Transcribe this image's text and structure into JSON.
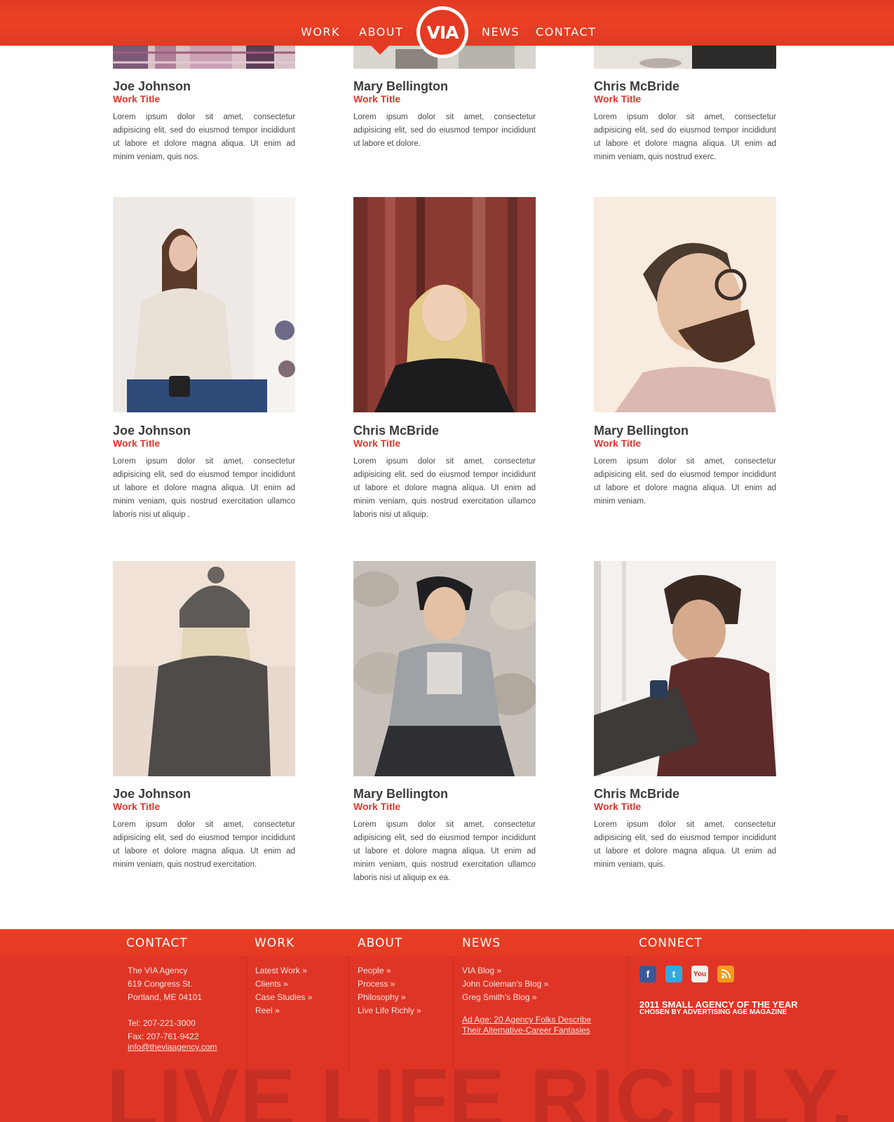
{
  "nav": {
    "items": [
      "WORK",
      "ABOUT",
      "NEWS",
      "CONTACT"
    ],
    "logo": "VIA",
    "active": "ABOUT"
  },
  "profiles": [
    {
      "name": "Joe Johnson",
      "title": "Work Title",
      "bio": "Lorem ipsum dolor sit amet, consectetur adipisicing elit, sed do eiusmod tempor incididunt ut labore et dolore magna aliqua. Ut enim ad minim veniam, quis nos."
    },
    {
      "name": "Mary Bellington",
      "title": "Work Title",
      "bio": "Lorem ipsum dolor sit amet, consectetur adipisicing elit, sed do eiusmod tempor incididunt ut labore et dolore."
    },
    {
      "name": "Chris McBride",
      "title": "Work Title",
      "bio": "Lorem ipsum dolor sit amet, consectetur adipisicing elit, sed do eiusmod tempor incididunt ut labore et dolore magna aliqua. Ut enim ad minim veniam, quis nostrud exerc."
    },
    {
      "name": "Joe Johnson",
      "title": "Work Title",
      "bio": "Lorem ipsum dolor sit amet, consectetur adipisicing elit, sed do eiusmod tempor incididunt ut labore et dolore magna aliqua. Ut enim ad minim veniam, quis nostrud exercitation ullamco laboris nisi ut aliquip ."
    },
    {
      "name": "Chris McBride",
      "title": "Work Title",
      "bio": "Lorem ipsum dolor sit amet, consectetur adipisicing elit, sed do eiusmod tempor incididunt ut labore et dolore magna aliqua. Ut enim ad minim veniam, quis nostrud exercitation ullamco laboris nisi ut aliquip."
    },
    {
      "name": "Mary Bellington",
      "title": "Work Title",
      "bio": "Lorem ipsum dolor sit amet, consectetur adipisicing elit, sed do eiusmod tempor incididunt ut labore et dolore magna aliqua. Ut enim ad minim veniam."
    },
    {
      "name": "Joe Johnson",
      "title": "Work Title",
      "bio": "Lorem ipsum dolor sit amet, consectetur adipisicing elit, sed do eiusmod tempor incididunt ut labore et dolore magna aliqua. Ut enim ad minim veniam, quis nostrud exercitation."
    },
    {
      "name": "Mary Bellington",
      "title": "Work Title",
      "bio": "Lorem ipsum dolor sit amet, consectetur adipisicing elit, sed do eiusmod tempor incididunt ut labore et dolore magna aliqua. Ut enim ad minim veniam, quis nostrud exercitation ullamco laboris nisi ut aliquip ex ea."
    },
    {
      "name": "Chris McBride",
      "title": "Work Title",
      "bio": "Lorem ipsum dolor sit amet, consectetur adipisicing elit, sed do eiusmod tempor incididunt ut labore et dolore magna aliqua. Ut enim ad minim veniam, quis."
    }
  ],
  "footer": {
    "contact": {
      "heading": "CONTACT",
      "agency": "The VIA Agency",
      "street": "619 Congress St.",
      "city": "Portland, ME 04101",
      "tel": "Tel: 207-221-3000",
      "fax": "Fax: 207-761-9422",
      "email": "info@theviaagency.com"
    },
    "work": {
      "heading": "WORK",
      "links": [
        "Latest Work »",
        "Clients »",
        "Case Studies »",
        "Reel »"
      ]
    },
    "about": {
      "heading": "ABOUT",
      "links": [
        "People »",
        "Process »",
        "Philosophy »",
        "Live Life Richly »"
      ]
    },
    "news": {
      "heading": "NEWS",
      "links": [
        "VIA Blog »",
        "John Coleman’s Blog »",
        "Greg Smith’s Blog »"
      ],
      "article_line1": "Ad Age: 20 Agency Folks Describe",
      "article_line2": "Their Alternative-Career Fantasies"
    },
    "connect": {
      "heading": "CONNECT",
      "social_icons": [
        "facebook-icon",
        "twitter-icon",
        "youtube-icon",
        "rss-icon"
      ],
      "award_line1": "2011 SMALL AGENCY OF THE YEAR",
      "award_line2": "CHOSEN BY ADVERTISING AGE MAGAZINE"
    },
    "watermark": "LIVE LIFE RICHLY."
  },
  "colors": {
    "brand": "#e53a24",
    "footer": "#df3526",
    "name": "#3c3c3c",
    "title": "#e0352a"
  }
}
